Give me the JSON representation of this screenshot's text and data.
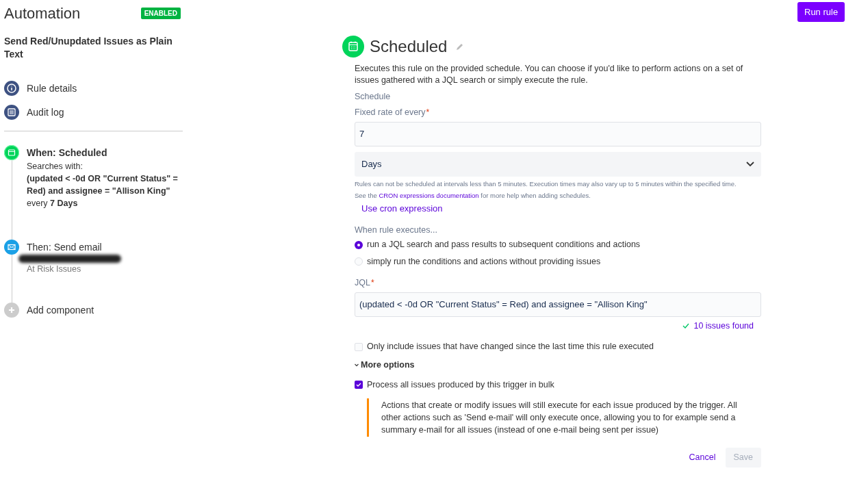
{
  "header": {
    "title": "Automation",
    "status_badge": "ENABLED",
    "enabled": true,
    "run_button": "Run rule"
  },
  "sidebar": {
    "rule_name": "Send Red/Unupdated Issues as Plain Text",
    "nav": [
      {
        "label": "Rule details",
        "kind": "info"
      },
      {
        "label": "Audit log",
        "kind": "log"
      }
    ],
    "components": [
      {
        "kind": "trigger",
        "title": "When: Scheduled",
        "selected": true,
        "lines": [
          "Searches with:",
          "**(updated < -0d OR \"Current Status\" = Red) and assignee = \"Allison King\"**",
          "every **7 Days**"
        ]
      },
      {
        "kind": "action",
        "title": "Then: Send email",
        "selected": false,
        "redacted": true,
        "lines": [
          "At Risk Issues"
        ]
      },
      {
        "kind": "add",
        "title": "Add component",
        "selected": false
      }
    ]
  },
  "panel": {
    "title": "Scheduled",
    "description": "Executes this rule on the provided schedule. You can choose if you'd like to perform actions on a set of issues gathered with a JQL search or simply execute the rule.",
    "section_label": "Schedule",
    "rate_label": "Fixed rate of every",
    "rate_required_mark": "*",
    "rate_value": "7",
    "unit_value": "Days",
    "hint": "Rules can not be scheduled at intervals less than 5 minutes. Execution times may also vary up to 5 minutes within the specified time.",
    "cron_hint_before": "See the",
    "cron_hint_link": "CRON expressions documentation",
    "cron_hint_after": "for more help when adding schedules.",
    "cron_link": "Use cron expression",
    "executes_label": "When rule executes...",
    "radios": [
      {
        "label": "run a JQL search and pass results to subsequent conditions and actions",
        "selected": true
      },
      {
        "label": "simply run the conditions and actions without providing issues",
        "selected": false
      }
    ],
    "jql_label": "JQL",
    "jql_required_mark": "*",
    "jql_value": "(updated < -0d OR \"Current Status\" = Red) and assignee = \"Allison King\"",
    "issues_found": "10 issues found",
    "only_changed": {
      "label": "Only include issues that have changed since the last time this rule executed",
      "checked": false
    },
    "more_options": {
      "label": "More options",
      "expanded": true
    },
    "bulk": {
      "label": "Process all issues produced by this trigger in bulk",
      "checked": true
    },
    "bulk_note": "Actions that create or modify issues will still execute for each issue produced by the trigger. All other actions such as 'Send e-mail' will only execute once, allowing you to for example send a summary e-mail for all issues (instead of one e-mail being sent per issue)",
    "cancel": "Cancel",
    "save": "Save",
    "save_disabled": true
  }
}
